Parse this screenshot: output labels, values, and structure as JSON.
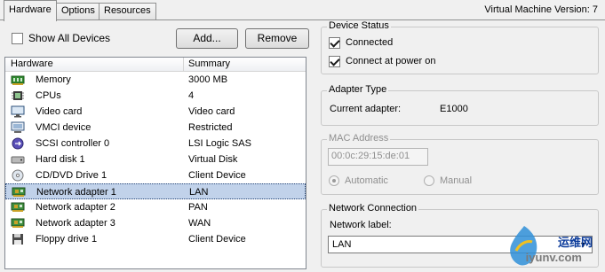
{
  "tabs": [
    {
      "label": "Hardware",
      "active": true
    },
    {
      "label": "Options",
      "active": false
    },
    {
      "label": "Resources",
      "active": false
    }
  ],
  "vm_version": "Virtual Machine Version: 7",
  "show_all_devices": {
    "label": "Show All Devices",
    "checked": false
  },
  "buttons": {
    "add": "Add...",
    "remove": "Remove"
  },
  "table": {
    "columns": [
      "Hardware",
      "Summary"
    ],
    "rows": [
      {
        "icon": "memory-icon",
        "name": "Memory",
        "summary": "3000 MB"
      },
      {
        "icon": "cpu-icon",
        "name": "CPUs",
        "summary": "4"
      },
      {
        "icon": "video-card-icon",
        "name": "Video card",
        "summary": "Video card"
      },
      {
        "icon": "vmci-icon",
        "name": "VMCI device",
        "summary": "Restricted"
      },
      {
        "icon": "scsi-controller-icon",
        "name": "SCSI controller 0",
        "summary": "LSI Logic SAS"
      },
      {
        "icon": "hard-disk-icon",
        "name": "Hard disk 1",
        "summary": "Virtual Disk"
      },
      {
        "icon": "cd-dvd-icon",
        "name": "CD/DVD Drive 1",
        "summary": "Client Device"
      },
      {
        "icon": "network-adapter-icon",
        "name": "Network adapter 1",
        "summary": "LAN",
        "selected": true
      },
      {
        "icon": "network-adapter-icon",
        "name": "Network adapter 2",
        "summary": "PAN"
      },
      {
        "icon": "network-adapter-icon",
        "name": "Network adapter 3",
        "summary": "WAN"
      },
      {
        "icon": "floppy-drive-icon",
        "name": "Floppy drive 1",
        "summary": "Client Device"
      }
    ]
  },
  "device_status": {
    "title": "Device Status",
    "connected": {
      "label": "Connected",
      "checked": true
    },
    "connect_at_power_on": {
      "label": "Connect at power on",
      "checked": true
    }
  },
  "adapter_type": {
    "title": "Adapter Type",
    "label": "Current adapter:",
    "value": "E1000"
  },
  "mac_address": {
    "title": "MAC Address",
    "value": "00:0c:29:15:de:01",
    "automatic": {
      "label": "Automatic",
      "selected": true
    },
    "manual": {
      "label": "Manual",
      "selected": false
    }
  },
  "network_connection": {
    "title": "Network Connection",
    "label": "Network label:",
    "value": "LAN"
  },
  "watermark": {
    "line1": "运维网",
    "line2": "iyunv.com"
  },
  "colors": {
    "selection": "#c1d2ea",
    "panel_bg": "#f0f0f0",
    "border": "#828790"
  }
}
